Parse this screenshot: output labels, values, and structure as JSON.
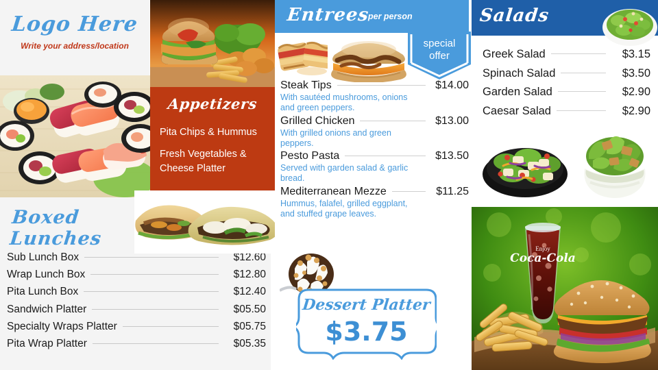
{
  "brand": {
    "logo_text": "Logo Here",
    "address_line": "Write your address/location",
    "logo_color": "#4a9bdc",
    "address_color": "#c0381a"
  },
  "appetizers": {
    "title": "Appetizers",
    "bg_color": "#bd3a12",
    "items": [
      "Pita Chips & Hummus",
      "Fresh Vegetables & Cheese Platter"
    ]
  },
  "boxed_lunches": {
    "title_line1": "Boxed",
    "title_line2": "Lunches",
    "items": [
      {
        "name": "Sub Lunch Box",
        "price": "$12.60"
      },
      {
        "name": "Wrap Lunch Box",
        "price": "$12.80"
      },
      {
        "name": "Pita Lunch Box",
        "price": "$12.40"
      },
      {
        "name": "Sandwich Platter",
        "price": "$05.50"
      },
      {
        "name": "Specialty Wraps Platter",
        "price": "$05.75"
      },
      {
        "name": "Pita Wrap Platter",
        "price": "$05.35"
      }
    ]
  },
  "entrees": {
    "title": "Entrees",
    "subtitle": "per person",
    "header_color": "#4a9bdc",
    "special_offer": {
      "line1": "special",
      "line2": "offer"
    },
    "items": [
      {
        "name": "Steak Tips",
        "price": "$14.00",
        "description": "With sautéed mushrooms, onions and green peppers."
      },
      {
        "name": "Grilled Chicken",
        "price": "$13.00",
        "description": "With grilled onions and green peppers."
      },
      {
        "name": "Pesto Pasta",
        "price": "$13.50",
        "description": "Served with garden salad & garlic bread."
      },
      {
        "name": "Mediterranean Mezze",
        "price": "$11.25",
        "description": "Hummus, falafel, grilled eggplant, and stuffed grape leaves."
      }
    ],
    "dessert": {
      "title": "Dessert Platter",
      "price": "$3.75"
    }
  },
  "salads": {
    "title": "Salads",
    "header_color": "#1f5fa8",
    "items": [
      {
        "name": "Greek Salad",
        "price": "$3.15"
      },
      {
        "name": "Spinach Salad",
        "price": "$3.50"
      },
      {
        "name": "Garden Salad",
        "price": "$2.90"
      },
      {
        "name": "Caesar Salad",
        "price": "$2.90"
      }
    ]
  },
  "photos": {
    "sushi": "sushi-platter-photo",
    "burger_top": "chicken-sandwich-fries-photo",
    "sandwich": "steak-sub-sandwich-photo",
    "entree_a": "grilled-panini-photo",
    "entree_b": "pulled-pork-cheese-burger-photo",
    "dessert": "whipped-cream-nut-dessert-photo",
    "salad_top": "salad-bowl-photo",
    "salad_a": "chicken-salad-bowl-photo",
    "salad_b": "caesar-salad-bowl-photo",
    "combo": "burger-fries-cola-combo-photo"
  }
}
